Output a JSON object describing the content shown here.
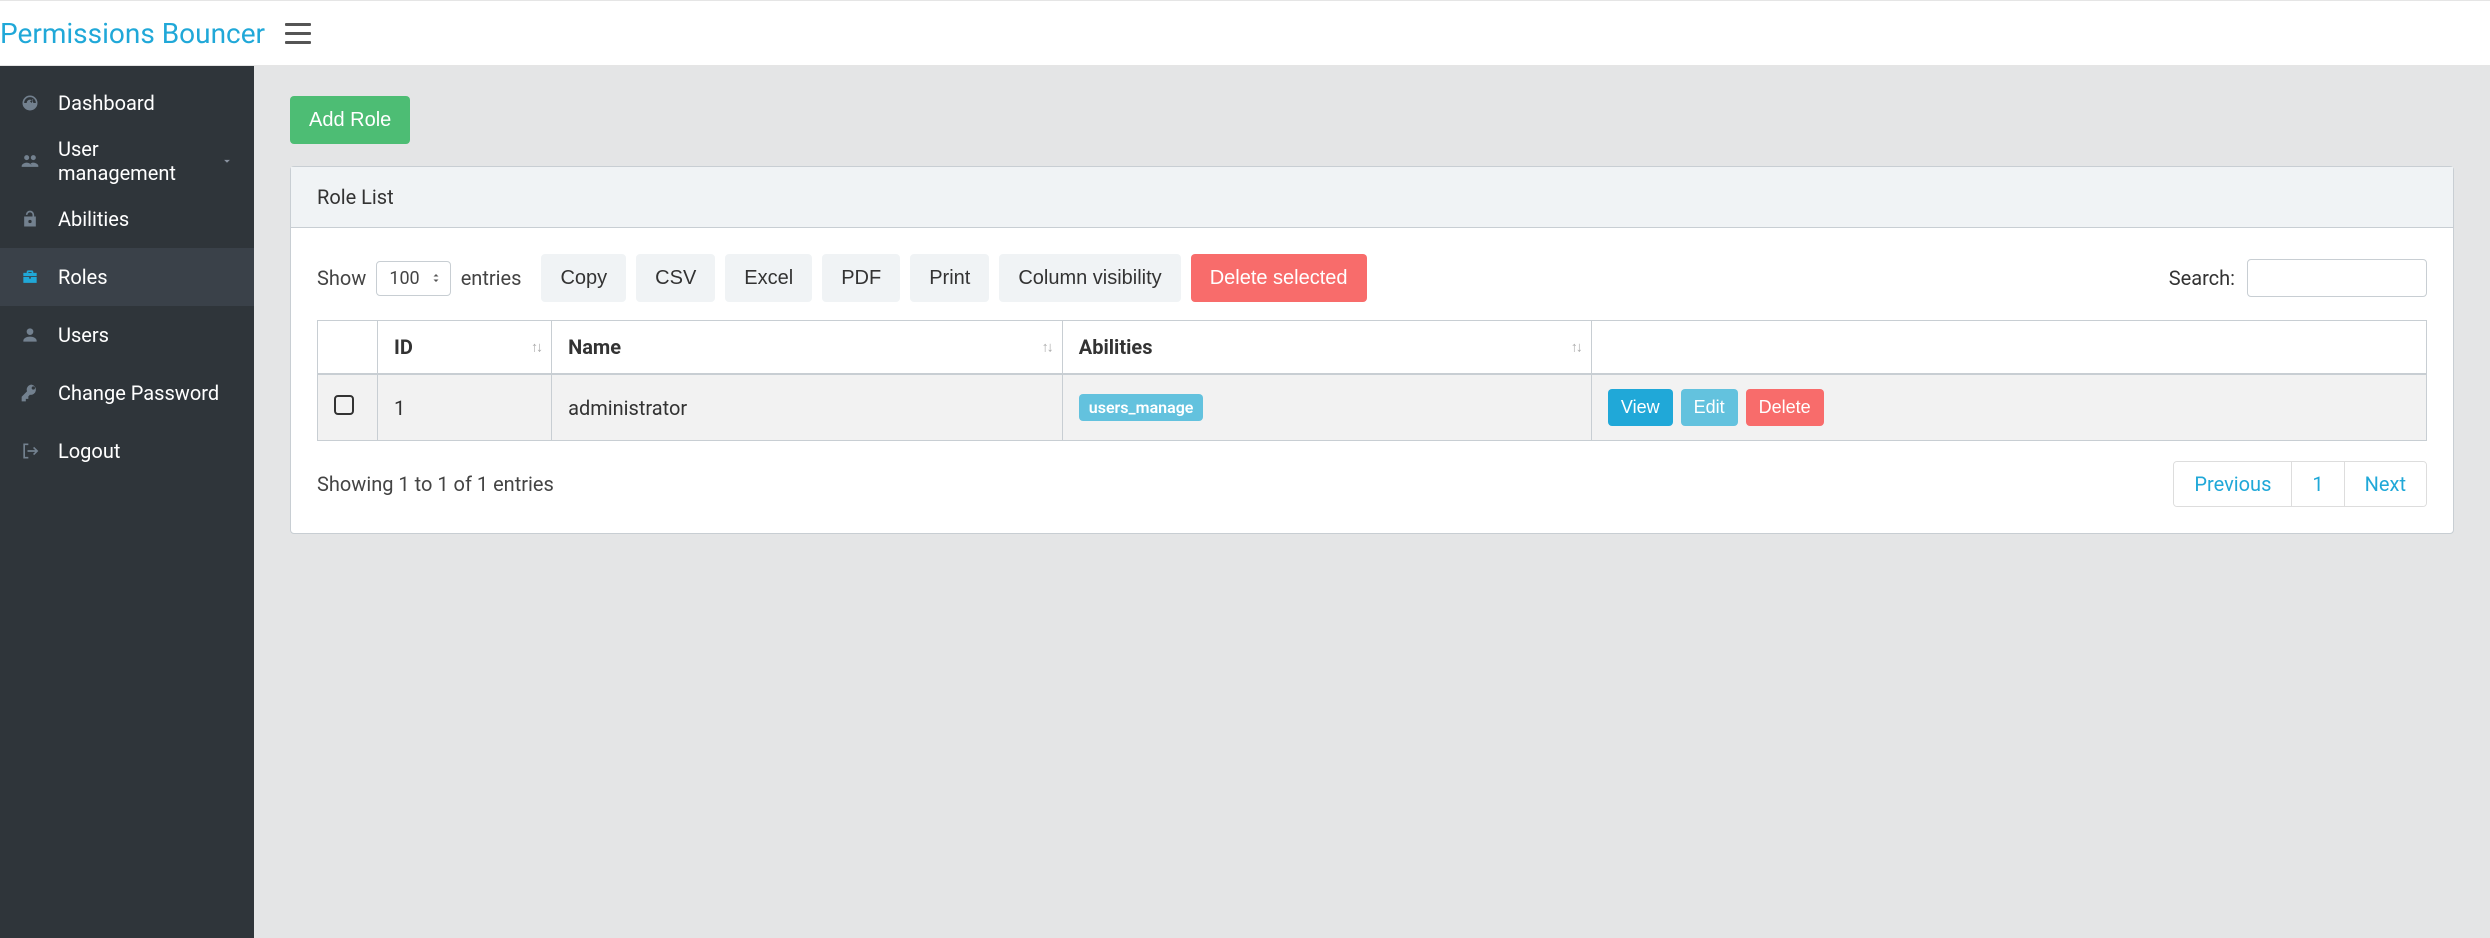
{
  "header": {
    "brand": "Permissions Bouncer"
  },
  "sidebar": {
    "items": [
      {
        "label": "Dashboard"
      },
      {
        "label": "User management"
      },
      {
        "label": "Abilities"
      },
      {
        "label": "Roles"
      },
      {
        "label": "Users"
      },
      {
        "label": "Change Password"
      },
      {
        "label": "Logout"
      }
    ]
  },
  "main": {
    "add_button": "Add Role",
    "card_title": "Role List",
    "length": {
      "show": "Show",
      "value": "100",
      "entries": "entries"
    },
    "buttons": {
      "copy": "Copy",
      "csv": "CSV",
      "excel": "Excel",
      "pdf": "PDF",
      "print": "Print",
      "colvis": "Column visibility",
      "delete_selected": "Delete selected"
    },
    "search_label": "Search:",
    "columns": {
      "id": "ID",
      "name": "Name",
      "abilities": "Abilities"
    },
    "rows": [
      {
        "id": "1",
        "name": "administrator",
        "abilities": [
          "users_manage"
        ]
      }
    ],
    "row_actions": {
      "view": "View",
      "edit": "Edit",
      "delete": "Delete"
    },
    "info": "Showing 1 to 1 of 1 entries",
    "pagination": {
      "previous": "Previous",
      "page": "1",
      "next": "Next"
    }
  }
}
